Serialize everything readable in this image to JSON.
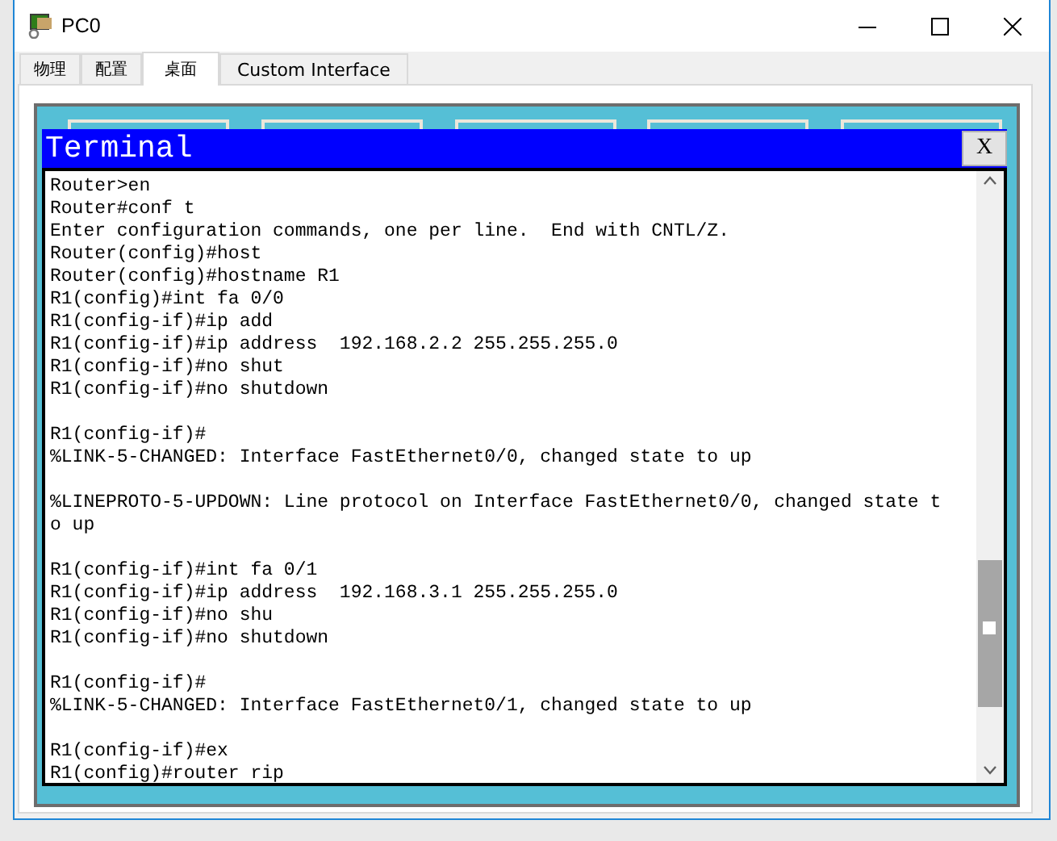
{
  "window": {
    "title": "PC0"
  },
  "tabs": [
    {
      "label": "物理",
      "selected": false
    },
    {
      "label": "配置",
      "selected": false
    },
    {
      "label": "桌面",
      "selected": true
    },
    {
      "label": "Custom Interface",
      "selected": false
    }
  ],
  "terminal": {
    "title": "Terminal",
    "close_label": "X",
    "blocks": [
      [
        "Router>en",
        "Router#conf t",
        "Enter configuration commands, one per line.  End with CNTL/Z.",
        "Router(config)#host",
        "Router(config)#hostname R1",
        "R1(config)#int fa 0/0",
        "R1(config-if)#ip add",
        "R1(config-if)#ip address  192.168.2.2 255.255.255.0",
        "R1(config-if)#no shut",
        "R1(config-if)#no shutdown"
      ],
      [
        "R1(config-if)#",
        "%LINK-5-CHANGED: Interface FastEthernet0/0, changed state to up"
      ],
      [
        "%LINEPROTO-5-UPDOWN: Line protocol on Interface FastEthernet0/0, changed state t",
        "o up"
      ],
      [
        "R1(config-if)#int fa 0/1",
        "R1(config-if)#ip address  192.168.3.1 255.255.255.0",
        "R1(config-if)#no shu",
        "R1(config-if)#no shutdown"
      ],
      [
        "R1(config-if)#",
        "%LINK-5-CHANGED: Interface FastEthernet0/1, changed state to up"
      ],
      [
        "R1(config-if)#ex",
        "R1(config)#router rip"
      ]
    ]
  }
}
